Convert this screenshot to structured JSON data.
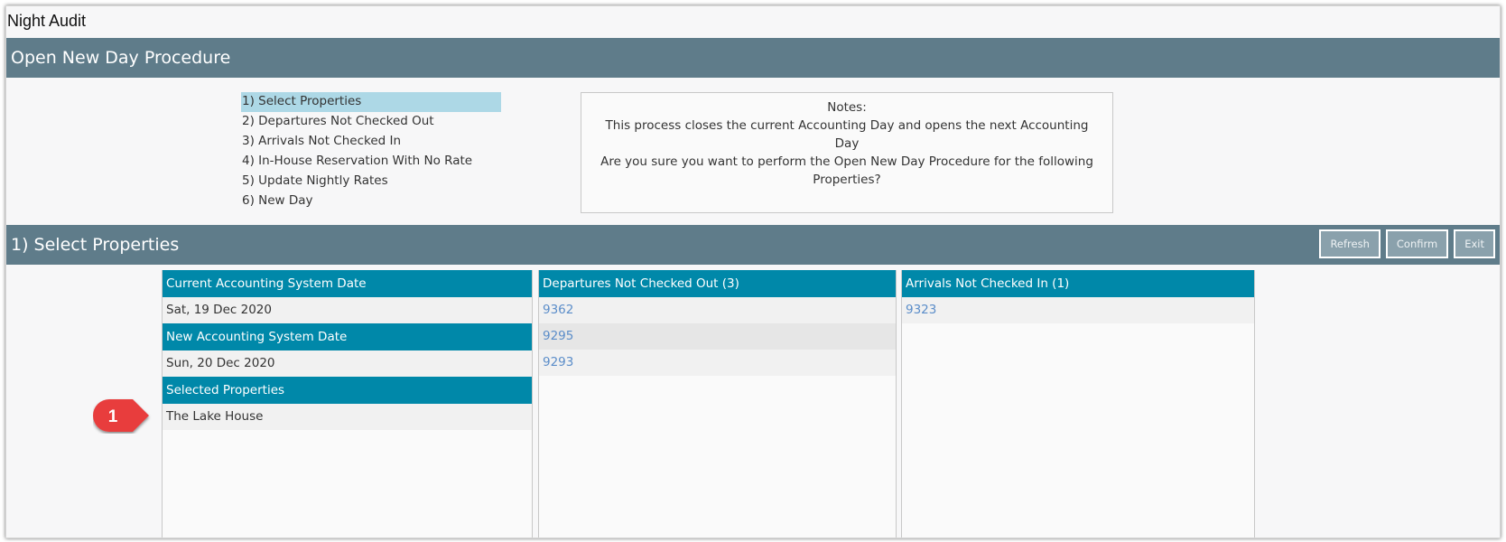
{
  "window": {
    "title": "Night Audit"
  },
  "procedure": {
    "title": "Open New Day Procedure"
  },
  "steps": [
    {
      "label": "1) Select Properties",
      "active": true
    },
    {
      "label": "2) Departures Not Checked Out",
      "active": false
    },
    {
      "label": "3) Arrivals Not Checked In",
      "active": false
    },
    {
      "label": "4) In-House Reservation With No Rate",
      "active": false
    },
    {
      "label": "5) Update Nightly Rates",
      "active": false
    },
    {
      "label": "6) New Day",
      "active": false
    }
  ],
  "notes": {
    "heading": "Notes:",
    "line1": "This process closes the current Accounting Day and opens the next Accounting Day",
    "line2": "Are you sure you want to perform the Open New Day Procedure for the following Properties?"
  },
  "section": {
    "title": "1) Select Properties",
    "buttons": {
      "refresh": "Refresh",
      "confirm": "Confirm",
      "exit": "Exit"
    }
  },
  "current_date": {
    "label": "Current Accounting System Date",
    "value": "Sat, 19 Dec 2020"
  },
  "new_date": {
    "label": "New Accounting System Date",
    "value": "Sun, 20 Dec 2020"
  },
  "selected_properties": {
    "label": "Selected Properties",
    "items": [
      "The Lake House"
    ]
  },
  "departures": {
    "label": "Departures Not Checked Out (3)",
    "items": [
      "9362",
      "9295",
      "9293"
    ]
  },
  "arrivals": {
    "label": "Arrivals Not Checked In (1)",
    "items": [
      "9323"
    ]
  },
  "callout": {
    "number": "1"
  },
  "colors": {
    "section_bar": "#5f7c8a",
    "column_header": "#0088a9",
    "active_step": "#add8e6",
    "link": "#5b8dc9",
    "callout": "#e83c3c"
  }
}
